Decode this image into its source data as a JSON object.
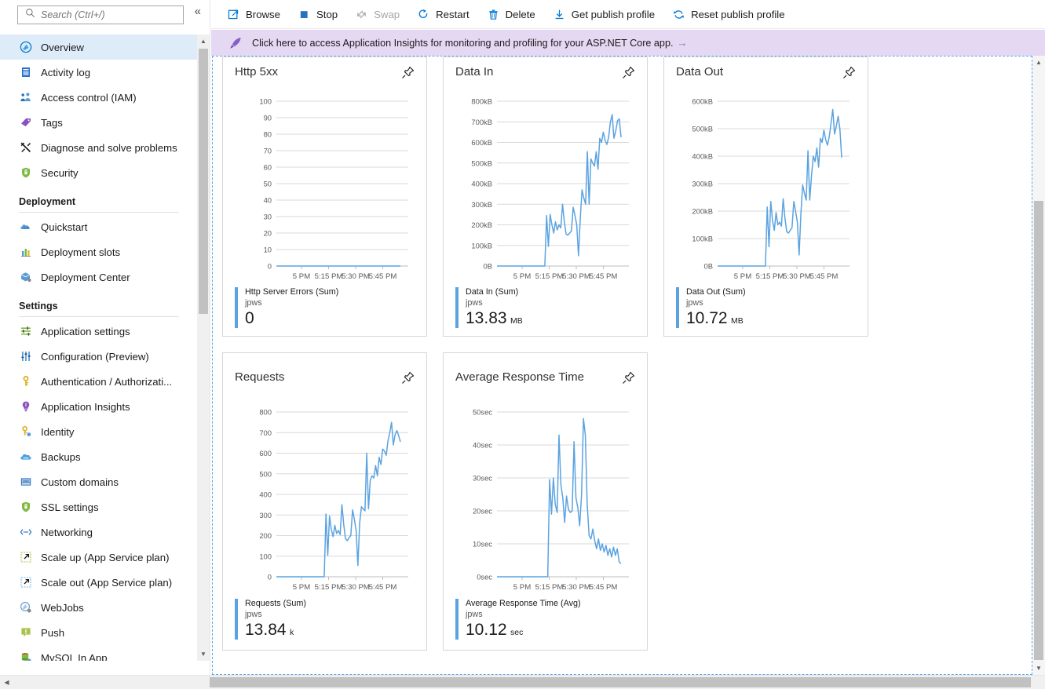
{
  "sidebar": {
    "search": {
      "placeholder": "Search (Ctrl+/)",
      "value": ""
    },
    "collapse_label": "«",
    "items": [
      {
        "label": "Overview",
        "icon": "overview-icon",
        "selected": true
      },
      {
        "label": "Activity log",
        "icon": "activity-log-icon",
        "selected": false
      },
      {
        "label": "Access control (IAM)",
        "icon": "access-control-icon",
        "selected": false
      },
      {
        "label": "Tags",
        "icon": "tag-icon",
        "selected": false
      },
      {
        "label": "Diagnose and solve problems",
        "icon": "wrench-icon",
        "selected": false
      },
      {
        "label": "Security",
        "icon": "shield-icon",
        "selected": false
      }
    ],
    "groups": [
      {
        "title": "Deployment",
        "items": [
          {
            "label": "Quickstart",
            "icon": "cloud-icon"
          },
          {
            "label": "Deployment slots",
            "icon": "bar-chart-icon"
          },
          {
            "label": "Deployment Center",
            "icon": "box-icon"
          }
        ]
      },
      {
        "title": "Settings",
        "items": [
          {
            "label": "Application settings",
            "icon": "sliders-icon"
          },
          {
            "label": "Configuration (Preview)",
            "icon": "equalizer-icon"
          },
          {
            "label": "Authentication / Authorizati...",
            "icon": "key-icon"
          },
          {
            "label": "Application Insights",
            "icon": "lightbulb-icon"
          },
          {
            "label": "Identity",
            "icon": "identity-key-icon"
          },
          {
            "label": "Backups",
            "icon": "backup-cloud-icon"
          },
          {
            "label": "Custom domains",
            "icon": "www-icon"
          },
          {
            "label": "SSL settings",
            "icon": "ssl-shield-icon"
          },
          {
            "label": "Networking",
            "icon": "network-icon"
          },
          {
            "label": "Scale up (App Service plan)",
            "icon": "scale-up-icon"
          },
          {
            "label": "Scale out (App Service plan)",
            "icon": "scale-out-icon"
          },
          {
            "label": "WebJobs",
            "icon": "webjobs-icon"
          },
          {
            "label": "Push",
            "icon": "push-icon"
          },
          {
            "label": "MySQL In App",
            "icon": "mysql-icon"
          }
        ]
      }
    ]
  },
  "toolbar": {
    "buttons": [
      {
        "label": "Browse",
        "icon": "external-link-icon",
        "disabled": false
      },
      {
        "label": "Stop",
        "icon": "stop-square-icon",
        "disabled": false
      },
      {
        "label": "Swap",
        "icon": "swap-arrows-icon",
        "disabled": true
      },
      {
        "label": "Restart",
        "icon": "restart-icon",
        "disabled": false
      },
      {
        "label": "Delete",
        "icon": "trash-icon",
        "disabled": false
      },
      {
        "label": "Get publish profile",
        "icon": "download-icon",
        "disabled": false
      },
      {
        "label": "Reset publish profile",
        "icon": "reset-icon",
        "disabled": false
      }
    ]
  },
  "banner": {
    "icon": "rocket-icon",
    "text": "Click here to access Application Insights for monitoring and profiling for your ASP.NET Core app.",
    "arrow": "→",
    "background": "#e5d8f2",
    "accent": "#8661c5"
  },
  "theme": {
    "line_color": "#5ba3e0",
    "accent_blue": "#0078d4",
    "grid_color": "#d9d9d9"
  },
  "chart_data": [
    {
      "type": "line",
      "title": "Http 5xx",
      "pin_label": "Pin to dashboard",
      "xlabel": "",
      "ylabel": "",
      "ytick_labels": [
        "100",
        "90",
        "80",
        "70",
        "60",
        "50",
        "40",
        "30",
        "20",
        "10",
        "0"
      ],
      "ylim": [
        0,
        100
      ],
      "xtick_labels": [
        "5 PM",
        "5:15 PM",
        "5:30 PM",
        "5:45 PM"
      ],
      "grid": true,
      "legend_position": "below",
      "legend": {
        "name": "Http Server Errors (Sum)",
        "resource": "jpws",
        "value": "0",
        "unit": ""
      },
      "values": [
        0,
        0,
        0,
        0,
        0,
        0,
        0,
        0,
        0,
        0,
        0,
        0,
        0,
        0,
        0,
        0,
        0,
        0,
        0,
        0,
        0,
        0,
        0,
        0,
        0,
        0,
        0,
        0,
        0,
        0,
        0,
        0,
        0,
        0,
        0,
        0,
        0,
        0,
        0,
        0,
        0,
        0,
        0,
        0,
        0,
        0,
        0,
        0,
        0,
        0,
        0,
        0,
        0,
        0,
        0,
        0,
        0,
        0,
        0,
        0
      ]
    },
    {
      "type": "line",
      "title": "Data In",
      "pin_label": "Pin to dashboard",
      "xlabel": "",
      "ylabel": "",
      "ytick_labels": [
        "800kB",
        "700kB",
        "600kB",
        "500kB",
        "400kB",
        "300kB",
        "200kB",
        "100kB",
        "0B"
      ],
      "ylim": [
        0,
        800
      ],
      "xtick_labels": [
        "5 PM",
        "5:15 PM",
        "5:30 PM",
        "5:45 PM"
      ],
      "grid": true,
      "legend_position": "below",
      "legend": {
        "name": "Data In (Sum)",
        "resource": "jpws",
        "value": "13.83",
        "unit": "MB"
      },
      "values": [
        0,
        0,
        0,
        0,
        0,
        0,
        0,
        0,
        0,
        0,
        0,
        0,
        0,
        0,
        0,
        0,
        0,
        0,
        0,
        0,
        0,
        0,
        0,
        0,
        0,
        0,
        0,
        0,
        245,
        95,
        250,
        200,
        160,
        215,
        175,
        200,
        185,
        300,
        215,
        155,
        150,
        160,
        170,
        285,
        245,
        200,
        50,
        230,
        370,
        330,
        300,
        555,
        300,
        520,
        500,
        485,
        555,
        470,
        620,
        600,
        650,
        610,
        590,
        625,
        700,
        735,
        620,
        655,
        705,
        715,
        625
      ]
    },
    {
      "type": "line",
      "title": "Data Out",
      "pin_label": "Pin to dashboard",
      "xlabel": "",
      "ylabel": "",
      "ytick_labels": [
        "600kB",
        "500kB",
        "400kB",
        "300kB",
        "200kB",
        "100kB",
        "0B"
      ],
      "ylim": [
        0,
        600
      ],
      "xtick_labels": [
        "5 PM",
        "5:15 PM",
        "5:30 PM",
        "5:45 PM"
      ],
      "grid": true,
      "legend_position": "below",
      "legend": {
        "name": "Data Out (Sum)",
        "resource": "jpws",
        "value": "10.72",
        "unit": "MB"
      },
      "values": [
        0,
        0,
        0,
        0,
        0,
        0,
        0,
        0,
        0,
        0,
        0,
        0,
        0,
        0,
        0,
        0,
        0,
        0,
        0,
        0,
        0,
        0,
        0,
        0,
        0,
        0,
        0,
        0,
        215,
        70,
        235,
        165,
        130,
        195,
        150,
        160,
        145,
        245,
        175,
        125,
        120,
        130,
        140,
        235,
        200,
        160,
        40,
        190,
        295,
        265,
        240,
        420,
        240,
        330,
        400,
        380,
        430,
        360,
        465,
        450,
        495,
        460,
        440,
        470,
        520,
        570,
        480,
        510,
        545,
        500,
        395
      ]
    },
    {
      "type": "line",
      "title": "Requests",
      "pin_label": "Pin to dashboard",
      "xlabel": "",
      "ylabel": "",
      "ytick_labels": [
        "800",
        "700",
        "600",
        "500",
        "400",
        "300",
        "200",
        "100",
        "0"
      ],
      "ylim": [
        0,
        800
      ],
      "xtick_labels": [
        "5 PM",
        "5:15 PM",
        "5:30 PM",
        "5:45 PM"
      ],
      "grid": true,
      "legend_position": "below",
      "legend": {
        "name": "Requests (Sum)",
        "resource": "jpws",
        "value": "13.84",
        "unit": "k"
      },
      "values": [
        0,
        0,
        0,
        0,
        0,
        0,
        0,
        0,
        0,
        0,
        0,
        0,
        0,
        0,
        0,
        0,
        0,
        0,
        0,
        0,
        0,
        0,
        0,
        0,
        0,
        0,
        0,
        0,
        305,
        105,
        295,
        230,
        195,
        250,
        210,
        225,
        205,
        350,
        255,
        185,
        175,
        190,
        200,
        325,
        280,
        225,
        55,
        260,
        340,
        330,
        320,
        600,
        330,
        470,
        490,
        480,
        540,
        490,
        580,
        545,
        620,
        610,
        590,
        660,
        700,
        750,
        640,
        690,
        710,
        685,
        655
      ]
    },
    {
      "type": "line",
      "title": "Average Response Time",
      "pin_label": "Pin to dashboard",
      "xlabel": "",
      "ylabel": "",
      "ytick_labels": [
        "50sec",
        "40sec",
        "30sec",
        "20sec",
        "10sec",
        "0sec"
      ],
      "ylim": [
        0,
        50
      ],
      "xtick_labels": [
        "5 PM",
        "5:15 PM",
        "5:30 PM",
        "5:45 PM"
      ],
      "grid": true,
      "legend_position": "below",
      "legend": {
        "name": "Average Response Time (Avg)",
        "resource": "jpws",
        "value": "10.12",
        "unit": "sec"
      },
      "values": [
        0,
        0,
        0,
        0,
        0,
        0,
        0,
        0,
        0,
        0,
        0,
        0,
        0,
        0,
        0,
        0,
        0,
        0,
        0,
        0,
        0,
        0,
        0,
        0,
        0,
        0,
        0,
        0,
        29.5,
        19,
        30,
        22,
        19.5,
        43,
        28,
        24,
        16.5,
        24.5,
        20.5,
        19.5,
        20,
        41,
        24,
        21,
        15.5,
        25,
        48,
        43,
        22,
        12.5,
        11.5,
        14.5,
        11,
        8.5,
        11.5,
        8,
        10,
        7.5,
        9.5,
        6.5,
        8.5,
        6,
        9,
        6.5,
        8.5,
        4.5,
        4
      ]
    }
  ],
  "scrollbars": {
    "sidebar_up": "▲",
    "sidebar_down": "▼",
    "page_up": "▲",
    "page_down": "▼",
    "page_left": "◀"
  }
}
